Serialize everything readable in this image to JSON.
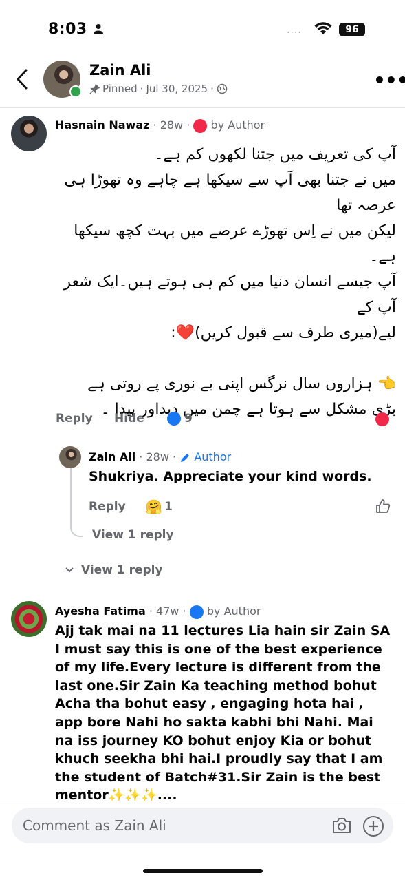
{
  "status_bar": {
    "time": "8:03",
    "signal_dots": "....",
    "battery": "96"
  },
  "header": {
    "name": "Zain Ali",
    "pinned": "Pinned",
    "date": "Jul 30, 2025",
    "sep": "·"
  },
  "comments": [
    {
      "author": "Hasnain Nawaz",
      "age": "28w",
      "badge": "by Author",
      "text_lines": [
        "آپ کی تعریف میں جتنا لکھوں کم ہے۔",
        "میں نے جتنا بھی آپ سے سیکھا ہے چاہے وہ تھوڑا ہی عرصہ تھا",
        "لیکن میں نے اِس تھوڑے عرصے میں بہت کچھ سیکھا ہے۔",
        "آپ جیسے انسان دنیا میں کم ہی ہوتے ہیں۔ایک شعر آپ کے",
        "لیے(میری طرف سے قبول کریں)❤️:",
        "",
        "👈 ہزاروں سال نرگس اپنی بے نوری پے روتی ہے",
        "بڑی مشکل سے ہوتا ہے چمن میں دیداور پیدا ۔"
      ],
      "actions": {
        "reply": "Reply",
        "hide": "Hide",
        "like_count": "9"
      },
      "reply": {
        "author": "Zain Ali",
        "age": "28w",
        "badge": "Author",
        "text": "Shukriya. Appreciate your kind words.",
        "reply_label": "Reply",
        "reaction_count": "1",
        "view_replies": "View 1 reply"
      },
      "view_replies": "View 1 reply"
    },
    {
      "author": "Ayesha Fatima",
      "age": "47w",
      "badge": "by Author",
      "text": "Ajj tak mai na 11 lectures Lia hain sir Zain SA I must say this is one of the best experience of my life.Every lecture is different from the last one.Sir Zain Ka teaching method bohut Acha tha bohut easy , engaging hota hai , app bore Nahi ho sakta kabhi bhi Nahi. Mai na iss journey KO bohut enjoy Kia or bohut khuch seekha bhi hai.I proudly say that I am the student of Batch#31.Sir Zain is the best mentor✨✨✨...."
    }
  ],
  "composer": {
    "placeholder": "Comment as Zain Ali"
  },
  "colors": {
    "accent": "#1877f2",
    "muted": "#65676b",
    "heart": "#f02849",
    "online": "#31a24c"
  },
  "icons": [
    "back-chevron-icon",
    "pin-icon",
    "globe-icon",
    "more-icon",
    "heart-icon",
    "like-icon",
    "pencil-icon",
    "thumbs-up-outline-icon",
    "camera-icon",
    "add-circle-icon",
    "wifi-icon",
    "person-icon"
  ]
}
